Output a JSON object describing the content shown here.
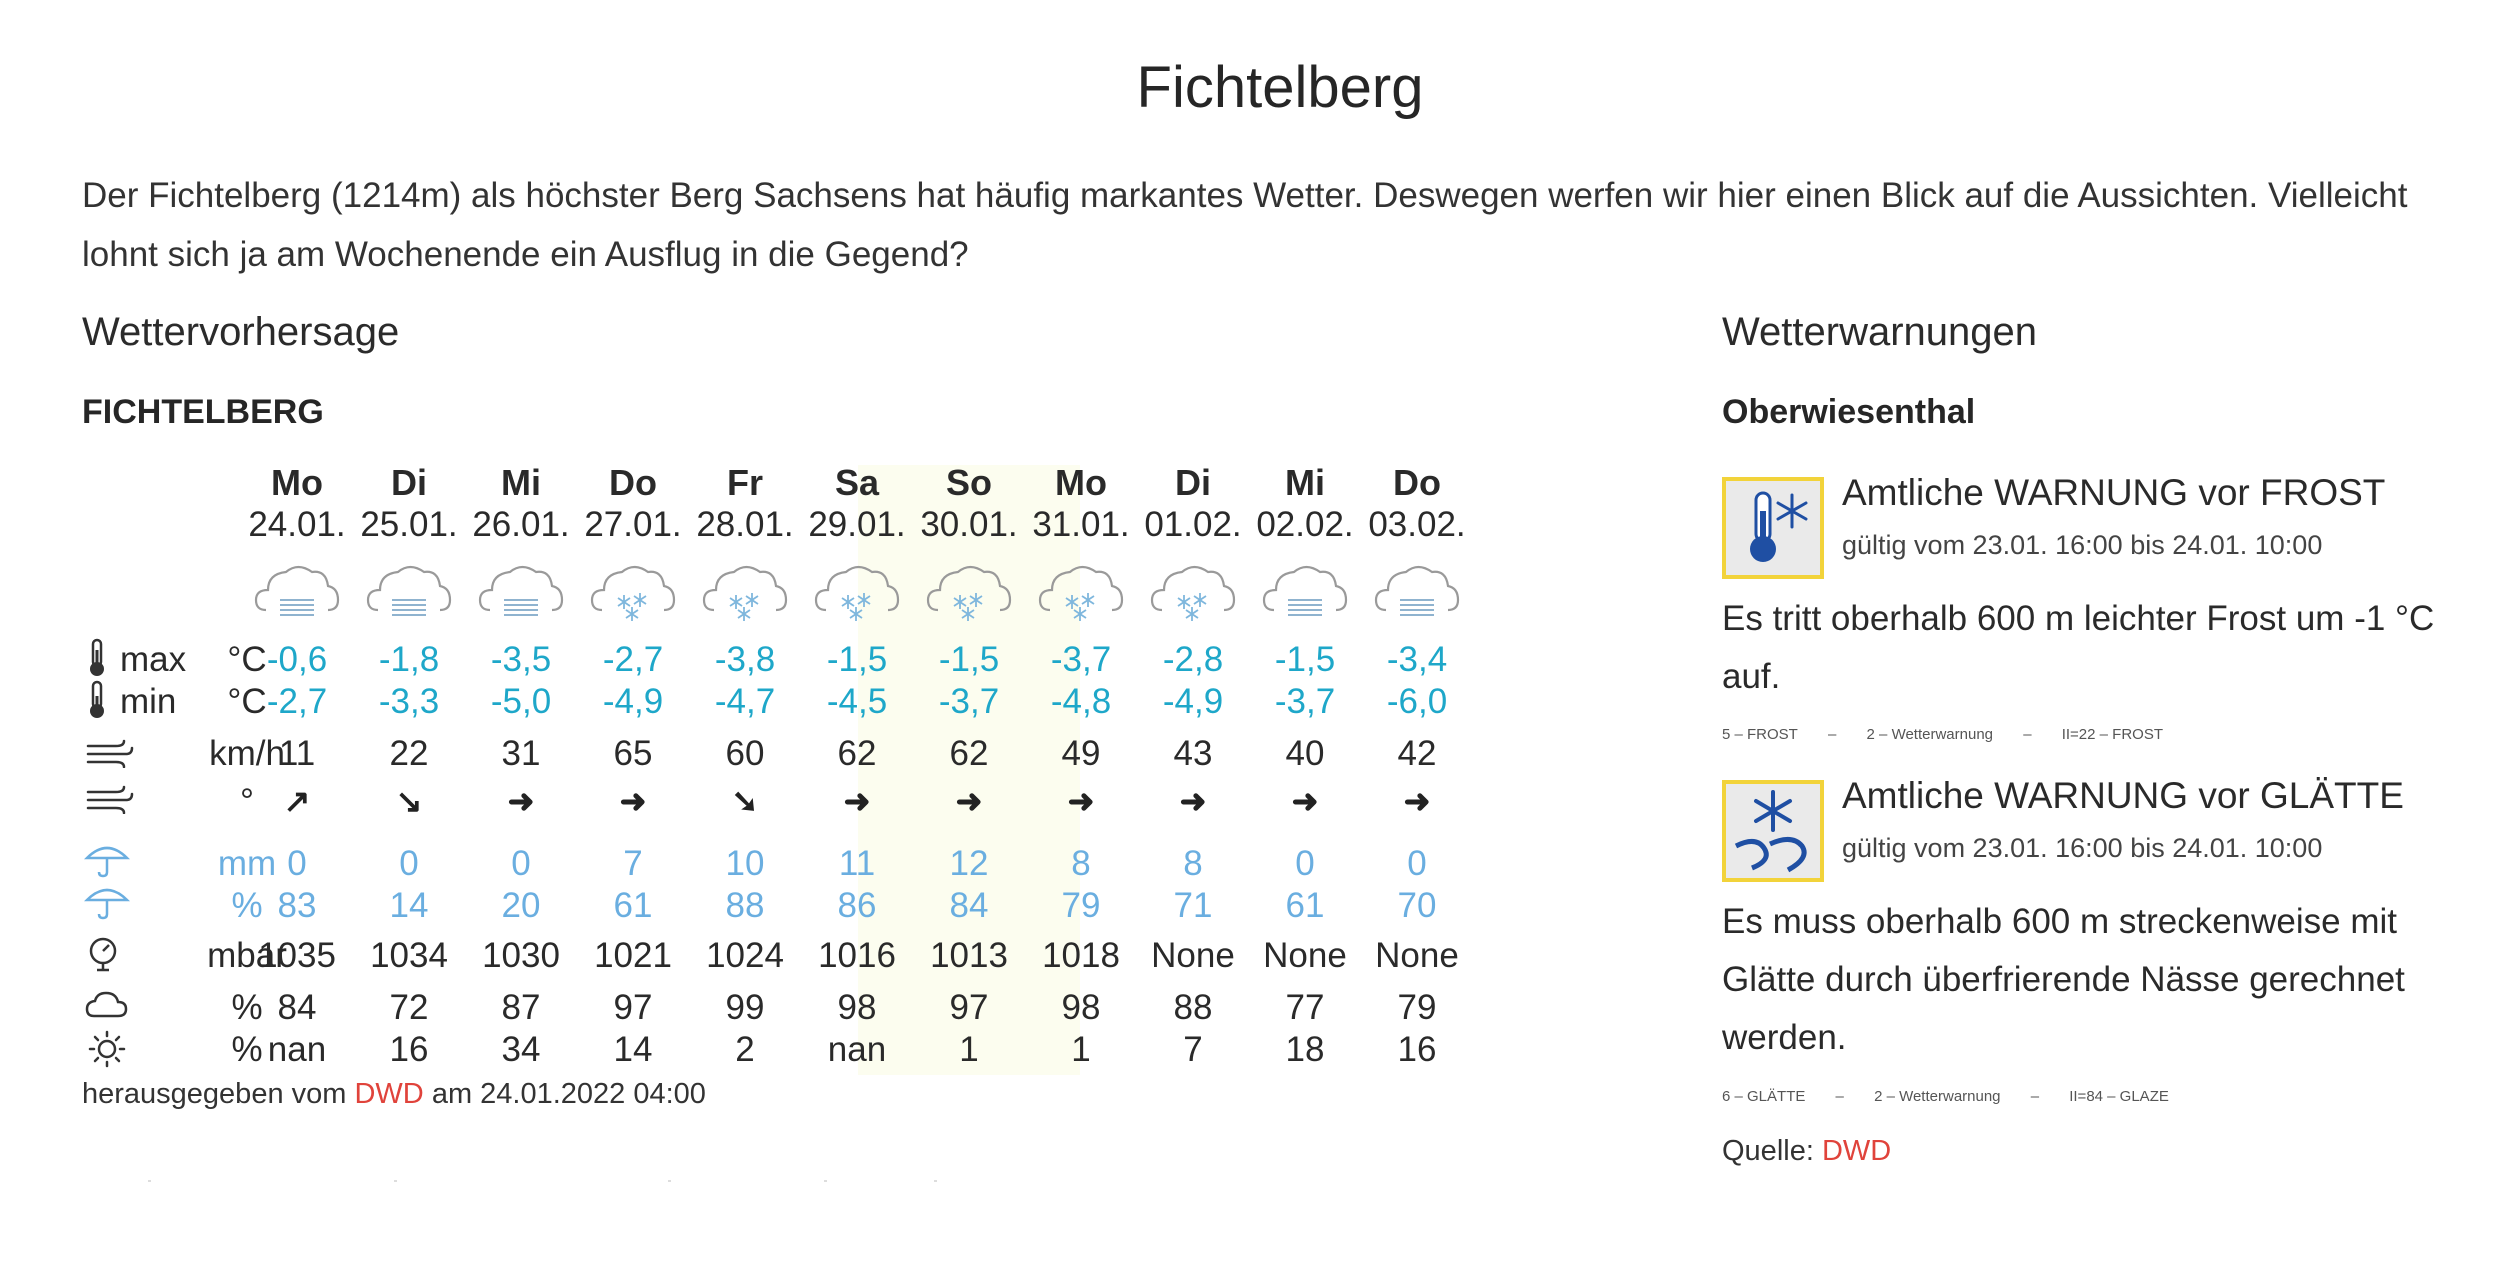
{
  "page": {
    "title": "Fichtelberg",
    "intro": "Der Fichtelberg (1214m) als höchster Berg Sachsens hat häufig markantes Wetter. Deswegen werfen wir hier einen Blick auf die Aussichten. Vielleicht lohnt sich ja am Wochenende ein Ausflug in die Gegend?"
  },
  "forecast": {
    "section_title": "Wettervorhersage",
    "station": "FICHTELBERG",
    "labels": {
      "max": "max",
      "min": "min"
    },
    "units": {
      "temp_max": "°C",
      "temp_min": "°C",
      "wind_speed": "km/h",
      "wind_dir": "°",
      "precip_amount": "mm",
      "precip_prob": "%",
      "pressure": "mbar",
      "clouds": "%",
      "sunshine": "%"
    },
    "days": [
      {
        "name": "Mo",
        "date": "24.01.",
        "icon": "cloud-fog-icon",
        "max": "-0,6",
        "min": "-2,7",
        "wind": "11",
        "dir": "↗",
        "mm": "0",
        "prob": "83",
        "pressure": "1035",
        "clouds": "84",
        "sun": "nan",
        "weekend": false
      },
      {
        "name": "Di",
        "date": "25.01.",
        "icon": "cloud-fog-icon",
        "max": "-1,8",
        "min": "-3,3",
        "wind": "22",
        "dir": "↘",
        "mm": "0",
        "prob": "14",
        "pressure": "1034",
        "clouds": "72",
        "sun": "16",
        "weekend": false
      },
      {
        "name": "Mi",
        "date": "26.01.",
        "icon": "cloud-fog-icon",
        "max": "-3,5",
        "min": "-5,0",
        "wind": "31",
        "dir": "➜",
        "mm": "0",
        "prob": "20",
        "pressure": "1030",
        "clouds": "87",
        "sun": "34",
        "weekend": false
      },
      {
        "name": "Do",
        "date": "27.01.",
        "icon": "cloud-snow-icon",
        "max": "-2,7",
        "min": "-4,9",
        "wind": "65",
        "dir": "➜",
        "mm": "7",
        "prob": "61",
        "pressure": "1021",
        "clouds": "97",
        "sun": "14",
        "weekend": false
      },
      {
        "name": "Fr",
        "date": "28.01.",
        "icon": "cloud-snow-icon",
        "max": "-3,8",
        "min": "-4,7",
        "wind": "60",
        "dir": "➘",
        "mm": "10",
        "prob": "88",
        "pressure": "1024",
        "clouds": "99",
        "sun": "2",
        "weekend": false
      },
      {
        "name": "Sa",
        "date": "29.01.",
        "icon": "cloud-snow-icon",
        "max": "-1,5",
        "min": "-4,5",
        "wind": "62",
        "dir": "➜",
        "mm": "11",
        "prob": "86",
        "pressure": "1016",
        "clouds": "98",
        "sun": "nan",
        "weekend": true
      },
      {
        "name": "So",
        "date": "30.01.",
        "icon": "cloud-snow-icon",
        "max": "-1,5",
        "min": "-3,7",
        "wind": "62",
        "dir": "➜",
        "mm": "12",
        "prob": "84",
        "pressure": "1013",
        "clouds": "97",
        "sun": "1",
        "weekend": true
      },
      {
        "name": "Mo",
        "date": "31.01.",
        "icon": "cloud-snow-icon",
        "max": "-3,7",
        "min": "-4,8",
        "wind": "49",
        "dir": "➜",
        "mm": "8",
        "prob": "79",
        "pressure": "1018",
        "clouds": "98",
        "sun": "1",
        "weekend": false
      },
      {
        "name": "Di",
        "date": "01.02.",
        "icon": "cloud-snow-icon",
        "max": "-2,8",
        "min": "-4,9",
        "wind": "43",
        "dir": "➜",
        "mm": "8",
        "prob": "71",
        "pressure": "None",
        "clouds": "88",
        "sun": "7",
        "weekend": false
      },
      {
        "name": "Mi",
        "date": "02.02.",
        "icon": "cloud-fog-icon",
        "max": "-1,5",
        "min": "-3,7",
        "wind": "40",
        "dir": "➜",
        "mm": "0",
        "prob": "61",
        "pressure": "None",
        "clouds": "77",
        "sun": "18",
        "weekend": false
      },
      {
        "name": "Do",
        "date": "03.02.",
        "icon": "cloud-fog-icon",
        "max": "-3,4",
        "min": "-6,0",
        "wind": "42",
        "dir": "➜",
        "mm": "0",
        "prob": "70",
        "pressure": "None",
        "clouds": "79",
        "sun": "16",
        "weekend": false
      }
    ],
    "footnote": {
      "prefix": "herausgegeben vom",
      "source": "DWD",
      "suffix": "am 24.01.2022 04:00"
    },
    "colors": {
      "temperature": "#1ea7c9",
      "precipitation": "#6aaee0",
      "weekend_background": "#fcfdef",
      "link": "#e0433b"
    }
  },
  "warnings": {
    "section_title": "Wetterwarnungen",
    "region": "Oberwiesenthal",
    "items": [
      {
        "icon": "frost-thermometer-icon",
        "title": "Amtliche WARNUNG vor FROST",
        "validity": "gültig vom 23.01. 16:00 bis 24.01. 10:00",
        "text": "Es tritt oberhalb 600 m leichter Frost um -1 °C auf.",
        "codes": [
          "5 – FROST",
          "–",
          "2 – Wetterwarnung",
          "–",
          "II=22 – FROST"
        ]
      },
      {
        "icon": "black-ice-road-icon",
        "title": "Amtliche WARNUNG vor GLÄTTE",
        "validity": "gültig vom 23.01. 16:00 bis 24.01. 10:00",
        "text": "Es muss oberhalb 600 m streckenweise mit Glätte durch überfrierende Nässe gerechnet werden.",
        "codes": [
          "6 – GLÄTTE",
          "–",
          "2 – Wetterwarnung",
          "–",
          "II=84 – GLAZE"
        ]
      }
    ],
    "source_label": "Quelle:",
    "source": "DWD"
  }
}
